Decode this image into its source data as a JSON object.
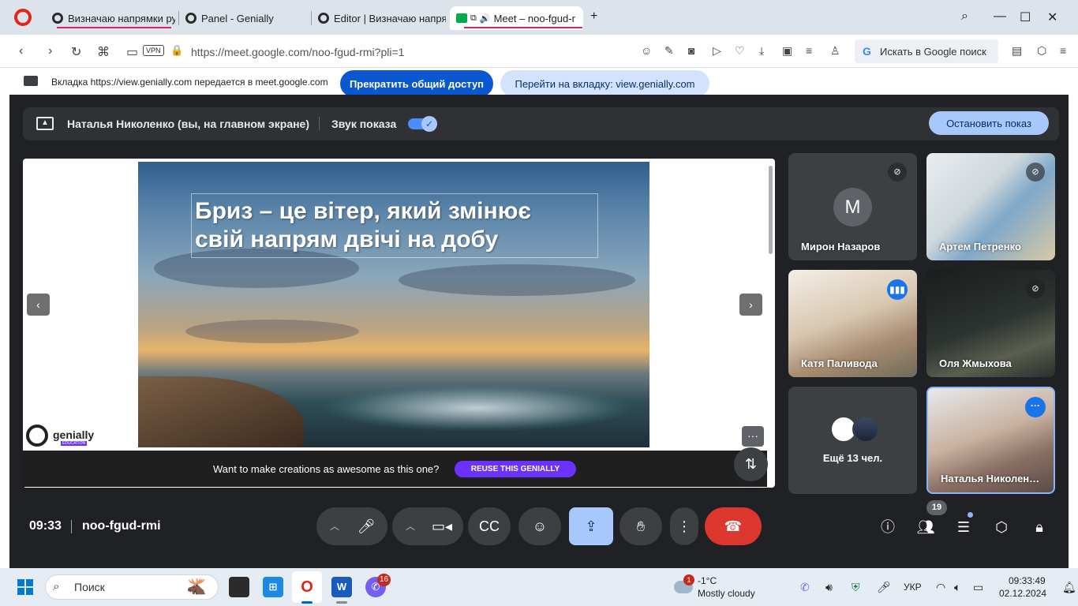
{
  "browser": {
    "tabs": [
      {
        "title": "Визначаю напрямки рухі"
      },
      {
        "title": "Panel - Genially"
      },
      {
        "title": "Editor | Визначаю напрям"
      },
      {
        "title": "Meet – noo-fgud-r"
      }
    ],
    "new_tab": "+",
    "url": "https://meet.google.com/noo-fgud-rmi?pli=1",
    "vpn_label": "VPN",
    "search_box": "Искать в Google поиск"
  },
  "share_bar": {
    "message": "Вкладка https://view.genially.com передается в meet.google.com",
    "stop_label": "Прекратить общий доступ",
    "goto_label": "Перейти на вкладку: view.genially.com"
  },
  "presenting": {
    "name": "Наталья Николенко (вы, на главном экране)",
    "sound_label": "Звук показа",
    "sound_on": true,
    "stop_label": "Остановить показ"
  },
  "slide": {
    "line1": "Бриз – це  вітер, який змінює",
    "line2": "свій напрям  двічі на добу",
    "logo_text": "genially",
    "logo_sub": "EDUCATION",
    "promo_text": "Want to make creations as awesome as this one?",
    "reuse_label": "REUSE THIS GENIALLY"
  },
  "participants": [
    {
      "name": "Мирон Назаров",
      "avatar": "M",
      "muted": true
    },
    {
      "name": "Артем Петренко",
      "muted": true
    },
    {
      "name": "Катя Паливода",
      "speaking": true
    },
    {
      "name": "Оля Жмыхова",
      "muted": true
    },
    {
      "more_label": "Ещё 13 чел."
    },
    {
      "name": "Наталья Николен…",
      "self": true
    }
  ],
  "meeting": {
    "time": "09:33",
    "code": "noo-fgud-rmi",
    "people_count": "19"
  },
  "taskbar": {
    "search_placeholder": "Поиск",
    "chat_badge": "16",
    "weather_badge": "1",
    "temperature": "-1°C",
    "weather": "Mostly cloudy",
    "language": "УКР",
    "time": "09:33:49",
    "date": "02.12.2024"
  },
  "colors": {
    "meet_bg": "#202124",
    "accent_blue": "#0b57d0",
    "hangup_red": "#dc362e",
    "genially_purple": "#6b32ff"
  }
}
